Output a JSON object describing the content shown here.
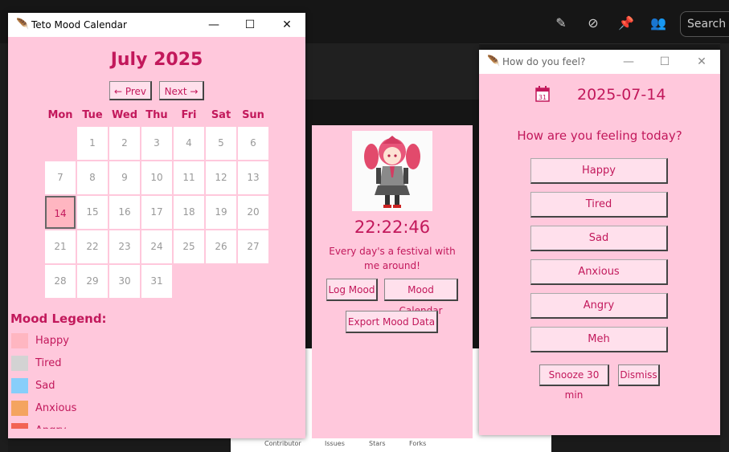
{
  "background": {
    "search_placeholder": "Search",
    "bottom_links": [
      "Contributor",
      "Issues",
      "Stars",
      "Forks"
    ]
  },
  "calendar_window": {
    "title": "Teto Mood Calendar",
    "month_label": "July 2025",
    "prev_label": "← Prev",
    "next_label": "Next →",
    "weekdays": [
      "Mon",
      "Tue",
      "Wed",
      "Thu",
      "Fri",
      "Sat",
      "Sun"
    ],
    "days": [
      "1",
      "2",
      "3",
      "4",
      "5",
      "6",
      "7",
      "8",
      "9",
      "10",
      "11",
      "12",
      "13",
      "14",
      "15",
      "16",
      "17",
      "18",
      "19",
      "20",
      "21",
      "22",
      "23",
      "24",
      "25",
      "26",
      "27",
      "28",
      "29",
      "30",
      "31"
    ],
    "selected_day": "14",
    "legend_title": "Mood Legend:",
    "legend": [
      {
        "label": "Happy",
        "color": "#ffb6c1"
      },
      {
        "label": "Tired",
        "color": "#d3d3d3"
      },
      {
        "label": "Sad",
        "color": "#87cefa"
      },
      {
        "label": "Anxious",
        "color": "#f4a460"
      },
      {
        "label": "Angry",
        "color": "#f26454"
      }
    ]
  },
  "clock_widget": {
    "time": "22:22:46",
    "motto": "Every day's a festival with me around!",
    "log_mood_label": "Log Mood",
    "mood_calendar_label": "Mood Calendar",
    "export_label": "Export Mood Data"
  },
  "prompt_window": {
    "title": "How do you feel?",
    "date": "2025-07-14",
    "question": "How are you feeling today?",
    "moods": [
      "Happy",
      "Tired",
      "Sad",
      "Anxious",
      "Angry",
      "Meh"
    ],
    "snooze_label": "Snooze 30 min",
    "dismiss_label": "Dismiss"
  },
  "colors": {
    "accent": "#c2185b",
    "window_bg": "#ffc8dc",
    "button_bg": "#ffe0ec"
  }
}
